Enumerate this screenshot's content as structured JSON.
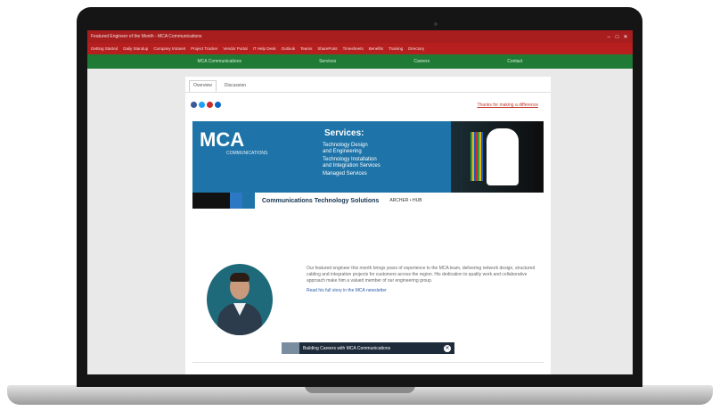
{
  "browser": {
    "title": "Featured Engineer of the Month - MCA Communications",
    "window_controls": [
      "–",
      "□",
      "✕"
    ],
    "bookmarks": [
      "Getting Started",
      "Daily Standup",
      "Company Intranet",
      "Project Tracker",
      "Vendor Portal",
      "IT Help Desk",
      "Outlook",
      "Teams",
      "SharePoint",
      "Timesheets",
      "Benefits",
      "Training",
      "Directory"
    ]
  },
  "site_nav": [
    "MCA Communications",
    "Services",
    "Careers",
    "Contact"
  ],
  "tabs": [
    "Overview",
    "Discussion"
  ],
  "social_icons": [
    "facebook-icon",
    "twitter-icon",
    "youtube-icon",
    "linkedin-icon"
  ],
  "top_link": "Thanks for making a difference",
  "banner": {
    "logo": "MCA",
    "logo_sub": "COMMUNICATIONS",
    "services_title": "Services:",
    "services": [
      "Technology Design",
      "and Engineering",
      "Technology Installation",
      "and Integration Services",
      "Managed Services"
    ],
    "tagline": "Communications Technology Solutions",
    "partners": "ARCHER  •  HUB"
  },
  "bio": {
    "paragraph": "Our featured engineer this month brings years of experience to the MCA team, delivering network design, structured cabling and integration projects for customers across the region. His dedication to quality work and collaborative approach make him a valued member of our engineering group.",
    "link": "Read his full story in the MCA newsletter"
  },
  "video_bar": {
    "text": "Building Careers with MCA Communications",
    "close": "✕"
  },
  "colors": {
    "titlebar": "#a81d1d",
    "bookmarks": "#b71f1f",
    "site_nav": "#1f7a35",
    "banner": "#1e73a8",
    "link": "#c0392b"
  }
}
